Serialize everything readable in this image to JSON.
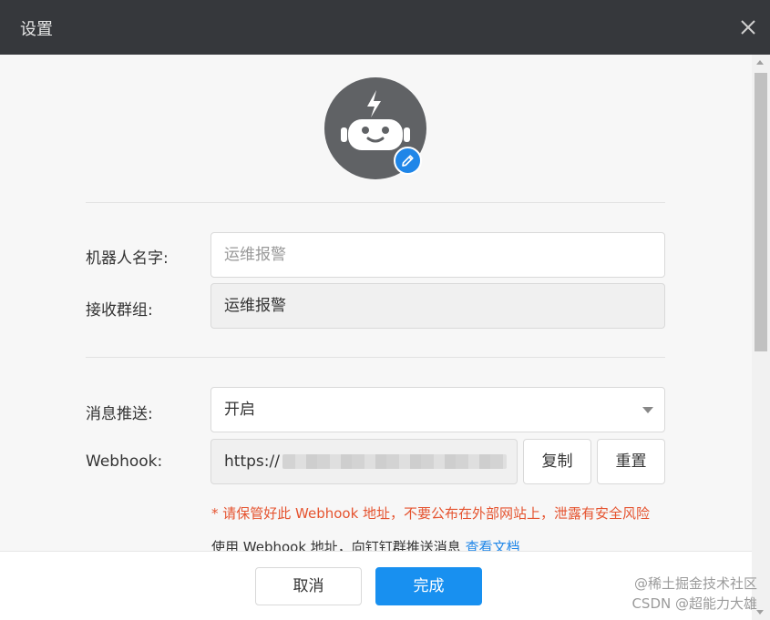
{
  "dialog": {
    "title": "设置"
  },
  "profile": {
    "avatar_icon": "robot-icon",
    "edit_icon": "pencil-icon"
  },
  "form": {
    "robot_name": {
      "label": "机器人名字:",
      "placeholder": "运维报警"
    },
    "receive_group": {
      "label": "接收群组:",
      "value": "运维报警"
    },
    "message_push": {
      "label": "消息推送:",
      "value": "开启"
    },
    "webhook": {
      "label": "Webhook:",
      "value": "https://",
      "copy_label": "复制",
      "reset_label": "重置"
    },
    "warning": "* 请保管好此 Webhook 地址，不要公布在外部网站上，泄露有安全风险",
    "hint_text": "使用 Webhook 地址，向钉钉群推送消息",
    "hint_link": "查看文档"
  },
  "footer": {
    "cancel_label": "取消",
    "done_label": "完成"
  },
  "watermark": {
    "line1": "@稀土掘金技术社区",
    "line2": "CSDN @超能力大雄"
  },
  "colors": {
    "primary": "#1890f0",
    "warning": "#e5532f",
    "titlebar": "#36383c"
  }
}
